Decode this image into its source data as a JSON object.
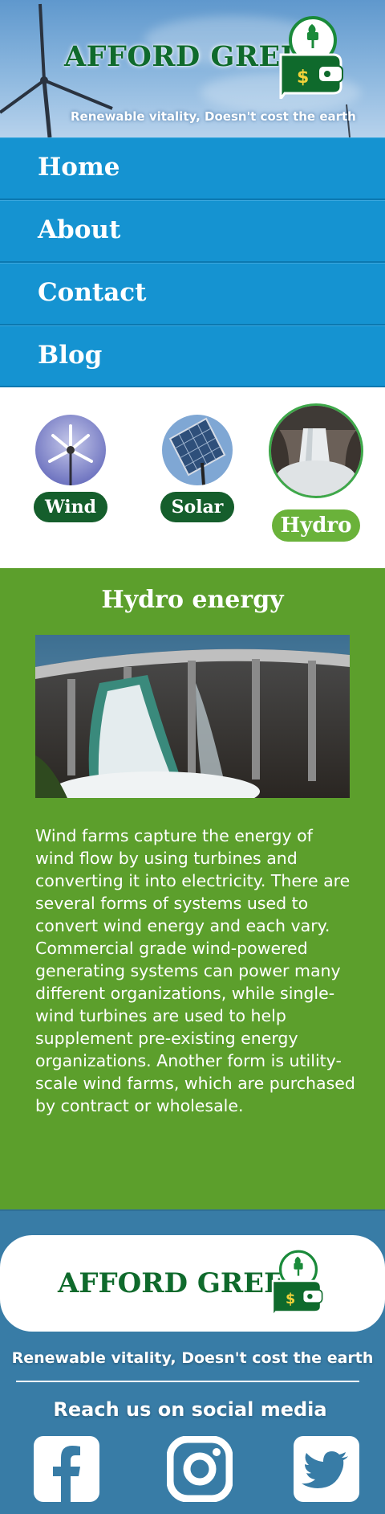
{
  "header": {
    "logo_text": "AFFORD GREEN",
    "tagline": "Renewable vitality, Doesn't cost the earth"
  },
  "nav": {
    "items": [
      {
        "label": "Home"
      },
      {
        "label": "About"
      },
      {
        "label": "Contact"
      },
      {
        "label": "Blog"
      }
    ]
  },
  "energy_selector": {
    "options": [
      {
        "label": "Wind",
        "selected": false
      },
      {
        "label": "Solar",
        "selected": false
      },
      {
        "label": "Hydro",
        "selected": true
      }
    ]
  },
  "content": {
    "title": "Hydro energy",
    "body": "Wind farms capture the energy of wind flow by using turbines and converting it into electricity. There are several forms of systems used to convert wind energy and each vary. Commercial grade wind-powered generating systems can power many different organizations, while single-wind turbines are used to help supplement pre-existing energy organizations. Another form is utility-scale wind farms, which are purchased by contract or wholesale."
  },
  "footer": {
    "logo_text": "AFFORD GREEN",
    "tagline": "Renewable vitality, Doesn't cost the earth",
    "social_heading": "Reach us on social media",
    "social_icons": [
      "facebook-icon",
      "instagram-icon",
      "twitter-icon"
    ]
  },
  "colors": {
    "brand_green": "#0f6a2c",
    "nav_blue": "#1593d1",
    "content_green": "#5c9f2c",
    "footer_blue": "#387ca6",
    "pill_dark": "#155e2c",
    "pill_active": "#6ab23a"
  }
}
